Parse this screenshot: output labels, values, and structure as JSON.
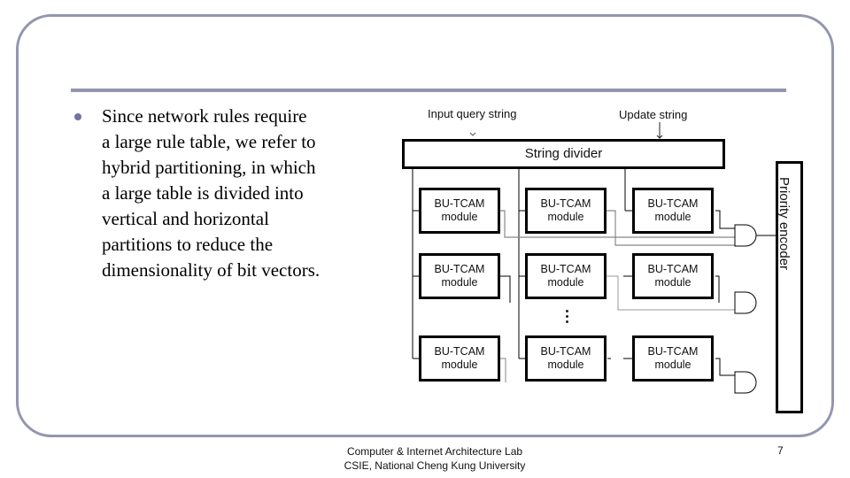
{
  "slide": {
    "bullets": [
      {
        "text": "Since network rules require\na large rule table, we refer to\nhybrid partitioning, in which\na large table is divided into\nvertical and horizontal\npartitions to reduce the\ndimensionality of bit vectors."
      }
    ],
    "footer": {
      "line1": "Computer & Internet Architecture Lab",
      "line2": "CSIE, National Cheng Kung University"
    },
    "page_number": "7"
  },
  "diagram": {
    "input_label": "Input query string",
    "update_label": "Update string",
    "divider_label": "String divider",
    "encoder_label": "Priority encoder",
    "module_line1": "BU-TCAM",
    "module_line2": "module",
    "modules": [
      {
        "row": 1,
        "col": 1
      },
      {
        "row": 1,
        "col": 2
      },
      {
        "row": 1,
        "col": 3
      },
      {
        "row": 2,
        "col": 1
      },
      {
        "row": 2,
        "col": 2
      },
      {
        "row": 2,
        "col": 3
      },
      {
        "row": 3,
        "col": 1
      },
      {
        "row": 3,
        "col": 2
      },
      {
        "row": 3,
        "col": 3
      }
    ]
  },
  "colors": {
    "frame": "#9396ae",
    "bullet": "#6f72a4"
  }
}
